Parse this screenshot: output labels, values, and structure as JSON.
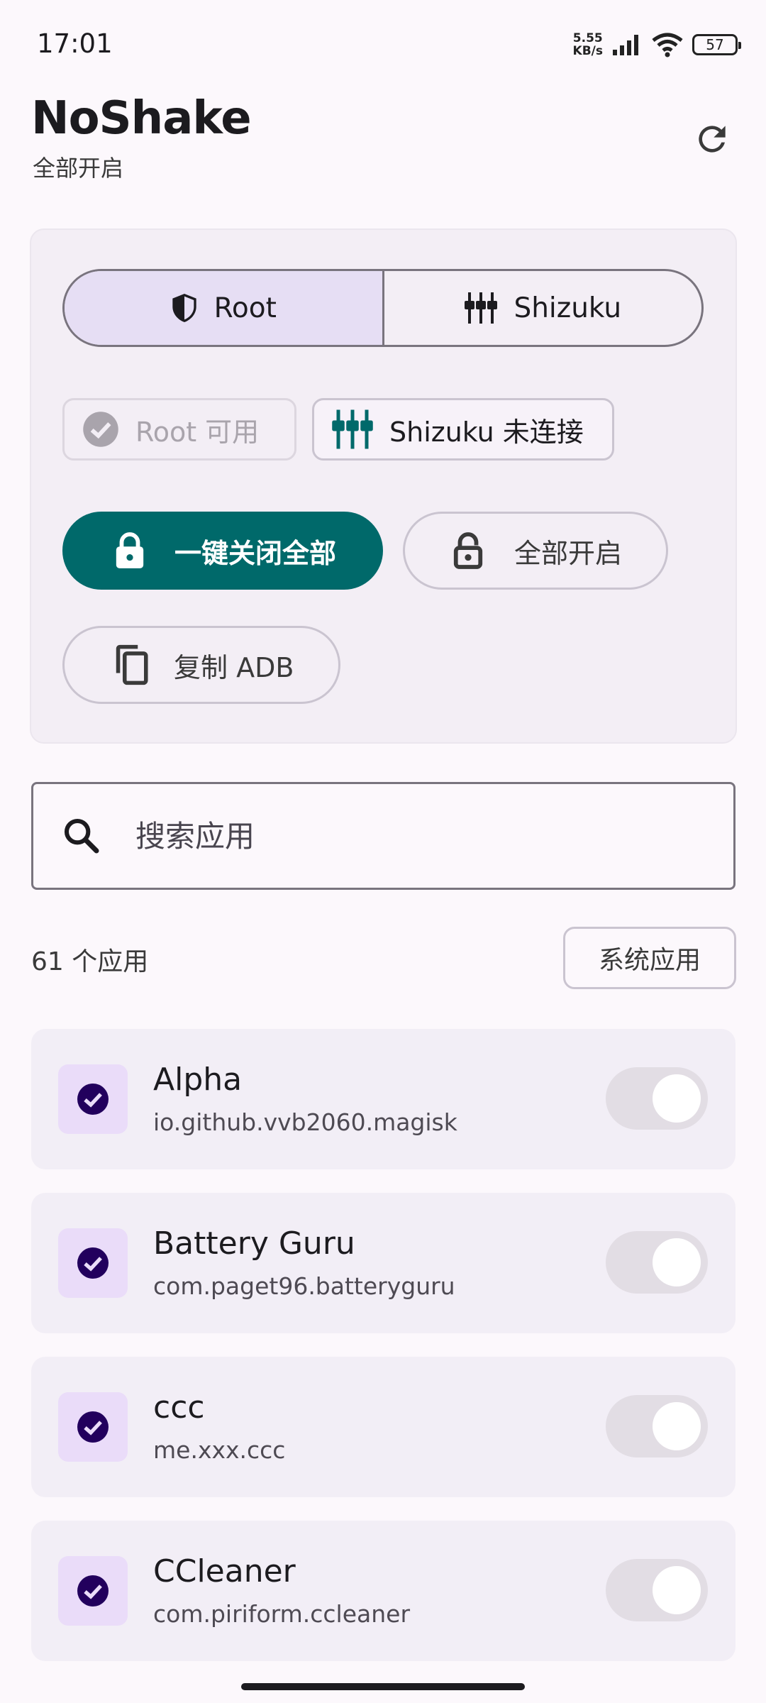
{
  "status_bar": {
    "time": "17:01",
    "net_speed_value": "5.55",
    "net_speed_unit": "KB/s",
    "battery": "57"
  },
  "header": {
    "title": "NoShake",
    "subtitle": "全部开启"
  },
  "mode_selector": {
    "root_label": "Root",
    "shizuku_label": "Shizuku",
    "selected": "Root"
  },
  "status_chips": {
    "root": "Root 可用",
    "shizuku": "Shizuku 未连接"
  },
  "actions": {
    "disable_all": "一键关闭全部",
    "enable_all": "全部开启",
    "copy_adb": "复制 ADB"
  },
  "search": {
    "placeholder": "搜索应用",
    "value": ""
  },
  "list_header": {
    "count": "61 个应用",
    "system_apps_button": "系统应用"
  },
  "apps": [
    {
      "name": "Alpha",
      "package": "io.github.vvb2060.magisk",
      "checked": true,
      "enabled": false
    },
    {
      "name": "Battery Guru",
      "package": "com.paget96.batteryguru",
      "checked": true,
      "enabled": false
    },
    {
      "name": "ccc",
      "package": "me.xxx.ccc",
      "checked": true,
      "enabled": false
    },
    {
      "name": "CCleaner",
      "package": "com.piriform.ccleaner",
      "checked": true,
      "enabled": false
    }
  ],
  "colors": {
    "accent": "#00696a",
    "check_circle": "#22005d",
    "segment_selected": "#e6def4",
    "card_background": "#f3eef5"
  }
}
